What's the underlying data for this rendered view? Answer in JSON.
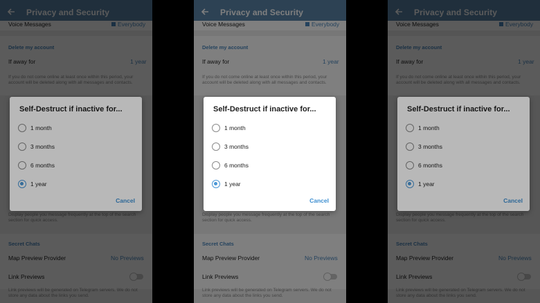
{
  "screen": {
    "title": "Privacy and Security",
    "voice_messages_label": "Voice Messages",
    "voice_messages_value": "Everybody",
    "delete_section_header": "Delete my account",
    "if_away_label": "If away for",
    "if_away_value": "1 year",
    "delete_hint": "If you do not come online at least once within this period, your account will be deleted along with all messages and contacts.",
    "suggest_hint": "Display people you message frequently at the top of the search section for quick access.",
    "secret_section_header": "Secret Chats",
    "map_preview_label": "Map Preview Provider",
    "map_preview_value": "No Previews",
    "link_previews_label": "Link Previews",
    "link_hint": "Link previews will be generated on Telegram servers. We do not store any data about the links you send."
  },
  "dialog": {
    "title": "Self-Destruct if inactive for...",
    "options": [
      {
        "label": "1 month",
        "selected": false
      },
      {
        "label": "3 months",
        "selected": false
      },
      {
        "label": "6 months",
        "selected": false
      },
      {
        "label": "1 year",
        "selected": true
      }
    ],
    "cancel_label": "Cancel"
  },
  "colors": {
    "app_bar": "#5b84a9",
    "accent": "#4b87bd",
    "radio_selected": "#4b97d6"
  }
}
